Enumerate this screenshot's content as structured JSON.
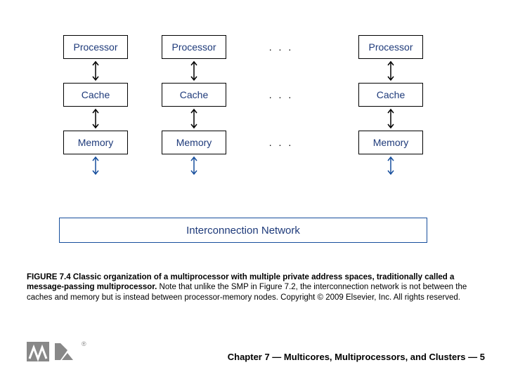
{
  "diagram": {
    "processor": "Processor",
    "cache": "Cache",
    "memory": "Memory",
    "ellipsis": ". . .",
    "interconnect": "Interconnection Network"
  },
  "caption": {
    "bold1": "FIGURE 7.4 Classic organization of a multiprocessor with multiple private address spaces, traditionally called a message-passing multiprocessor.",
    "rest": " Note that unlike the SMP in Figure 7.2, the interconnection network is not between the caches and memory but is instead between processor-memory nodes. Copyright © 2009 Elsevier, Inc. All rights reserved."
  },
  "footer": {
    "chapter": "Chapter 7 — Multicores, Multiprocessors, and Clusters — 5"
  }
}
